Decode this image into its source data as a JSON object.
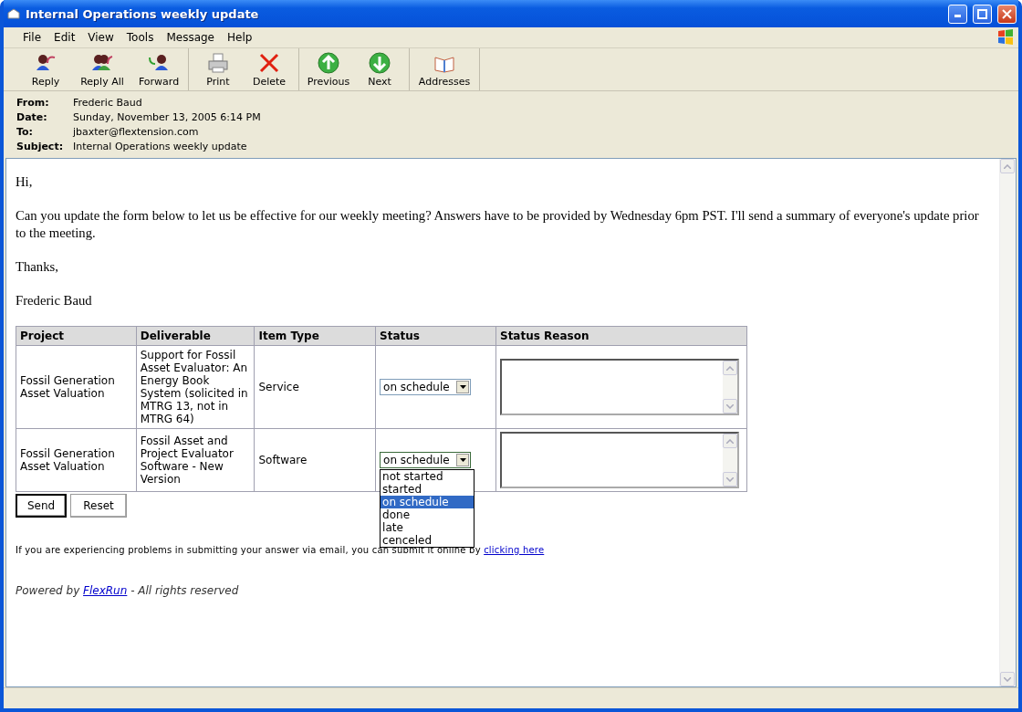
{
  "window": {
    "title": "Internal Operations weekly update"
  },
  "menu": [
    "File",
    "Edit",
    "View",
    "Tools",
    "Message",
    "Help"
  ],
  "toolbar_groups": [
    {
      "buttons": [
        {
          "label": "Reply",
          "kind": "reply"
        },
        {
          "label": "Reply All",
          "kind": "reply_all"
        },
        {
          "label": "Forward",
          "kind": "forward"
        }
      ]
    },
    {
      "buttons": [
        {
          "label": "Print",
          "kind": "print"
        },
        {
          "label": "Delete",
          "kind": "delete"
        }
      ]
    },
    {
      "buttons": [
        {
          "label": "Previous",
          "kind": "previous"
        },
        {
          "label": "Next",
          "kind": "next"
        }
      ]
    },
    {
      "buttons": [
        {
          "label": "Addresses",
          "kind": "addresses"
        }
      ]
    }
  ],
  "header": [
    {
      "label": "From:",
      "value": "Frederic Baud"
    },
    {
      "label": "Date:",
      "value": "Sunday, November 13, 2005 6:14 PM"
    },
    {
      "label": "To:",
      "value": "jbaxter@flextension.com"
    },
    {
      "label": "Subject:",
      "value": "Internal Operations weekly update"
    }
  ],
  "message": [
    "Hi,",
    "Can you update the form below to let us be effective for our weekly meeting? Answers have to be provided by Wednesday 6pm PST. I'll send a summary of everyone's update prior to the meeting.",
    "Thanks,",
    "Frederic Baud"
  ],
  "table": {
    "columns": [
      "Project",
      "Deliverable",
      "Item Type",
      "Status",
      "Status Reason"
    ],
    "rows": [
      {
        "project": "Fossil Generation Asset Valuation",
        "deliverable": "Support for Fossil Asset Evaluator: An Energy Book System (solicited in MTRG 13, not in MTRG 64)",
        "item_type": "Service",
        "status": {
          "value": "on schedule",
          "expanded": false
        }
      },
      {
        "project": "Fossil Generation Asset Valuation",
        "deliverable": "Fossil Asset and Project Evaluator Software - New Version",
        "item_type": "Software",
        "status": {
          "value": "on schedule",
          "expanded": true,
          "options": [
            {
              "label": "not started",
              "selected": false
            },
            {
              "label": "started",
              "selected": false
            },
            {
              "label": "on schedule",
              "selected": true
            },
            {
              "label": "done",
              "selected": false
            },
            {
              "label": "late",
              "selected": false
            },
            {
              "label": "cenceled",
              "selected": false
            }
          ]
        }
      }
    ]
  },
  "buttons": [
    {
      "label": "Send",
      "default": true
    },
    {
      "label": "Reset",
      "default": false
    }
  ],
  "note": {
    "text": "If you are experiencing problems in submitting your answer via email, you can submit it online by ",
    "link": "clicking here"
  },
  "footer": {
    "before": "Powered by ",
    "link": "FlexRun",
    "after": " - All rights reserved"
  }
}
